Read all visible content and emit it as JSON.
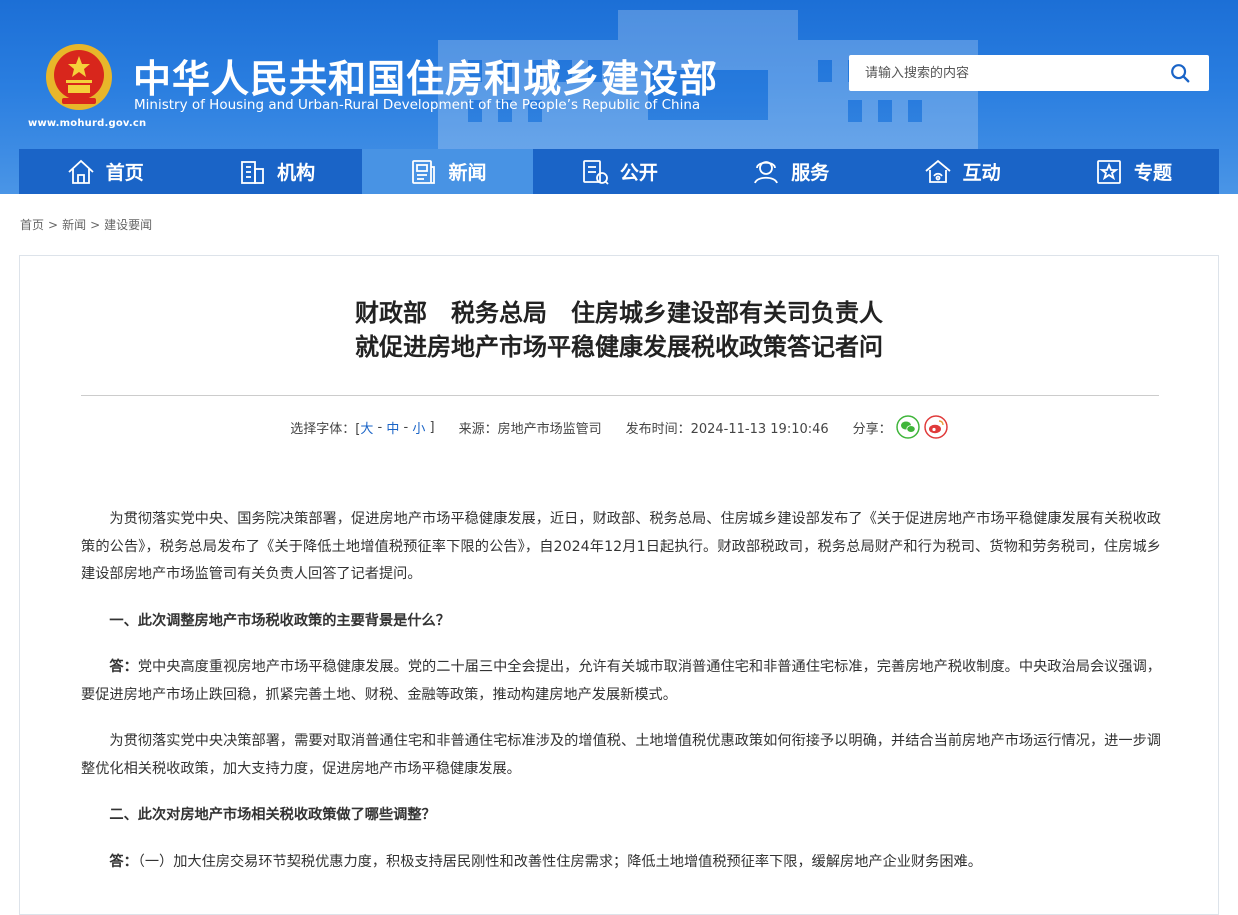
{
  "header": {
    "title": "中华人民共和国住房和城乡建设部",
    "subtitle": "Ministry of Housing and Urban-Rural Development of the People’s Republic of China",
    "url": "www.mohurd.gov.cn"
  },
  "search": {
    "placeholder": "请输入搜索的内容"
  },
  "nav": {
    "items": [
      {
        "label": "首页",
        "icon": "home-icon"
      },
      {
        "label": "机构",
        "icon": "building-icon"
      },
      {
        "label": "新闻",
        "icon": "news-icon",
        "active": true
      },
      {
        "label": "公开",
        "icon": "document-icon"
      },
      {
        "label": "服务",
        "icon": "service-icon"
      },
      {
        "label": "互动",
        "icon": "interact-icon"
      },
      {
        "label": "专题",
        "icon": "topic-icon"
      }
    ]
  },
  "breadcrumb": {
    "home": "首页",
    "sep": ">",
    "news": "新闻",
    "section": "建设要闻"
  },
  "article": {
    "title_line1": "财政部　税务总局　住房城乡建设部有关司负责人",
    "title_line2": "就促进房地产市场平稳健康发展税收政策答记者问",
    "font_label": "选择字体：[",
    "font_large": "大",
    "font_dash1": " - ",
    "font_medium": "中",
    "font_dash2": " - ",
    "font_small": "小",
    "font_close": " ]",
    "source": "来源：房地产市场监管司",
    "published": "发布时间：2024-11-13 19:10:46",
    "share_label": "分享：",
    "p1": "为贯彻落实党中央、国务院决策部署，促进房地产市场平稳健康发展，近日，财政部、税务总局、住房城乡建设部发布了《关于促进房地产市场平稳健康发展有关税收政策的公告》，税务总局发布了《关于降低土地增值税预征率下限的公告》，自2024年12月1日起执行。财政部税政司，税务总局财产和行为税司、货物和劳务税司，住房城乡建设部房地产市场监管司有关负责人回答了记者提问。",
    "q1": "一、此次调整房地产市场税收政策的主要背景是什么？",
    "a1_prefix": "答：",
    "a1": "党中央高度重视房地产市场平稳健康发展。党的二十届三中全会提出，允许有关城市取消普通住宅和非普通住宅标准，完善房地产税收制度。中央政治局会议强调，要促进房地产市场止跌回稳，抓紧完善土地、财税、金融等政策，推动构建房地产发展新模式。",
    "p2": "为贯彻落实党中央决策部署，需要对取消普通住宅和非普通住宅标准涉及的增值税、土地增值税优惠政策如何衔接予以明确，并结合当前房地产市场运行情况，进一步调整优化相关税收政策，加大支持力度，促进房地产市场平稳健康发展。",
    "q2": "二、此次对房地产市场相关税收政策做了哪些调整？",
    "a2_prefix": "答：",
    "a2": "（一）加大住房交易环节契税优惠力度，积极支持居民刚性和改善性住房需求；降低土地增值税预征率下限，缓解房地产企业财务困难。"
  },
  "colors": {
    "nav_bg": "#1a64c7",
    "nav_active": "#4893e4",
    "wechat": "#3fb53a",
    "weibo": "#e03a3a"
  }
}
